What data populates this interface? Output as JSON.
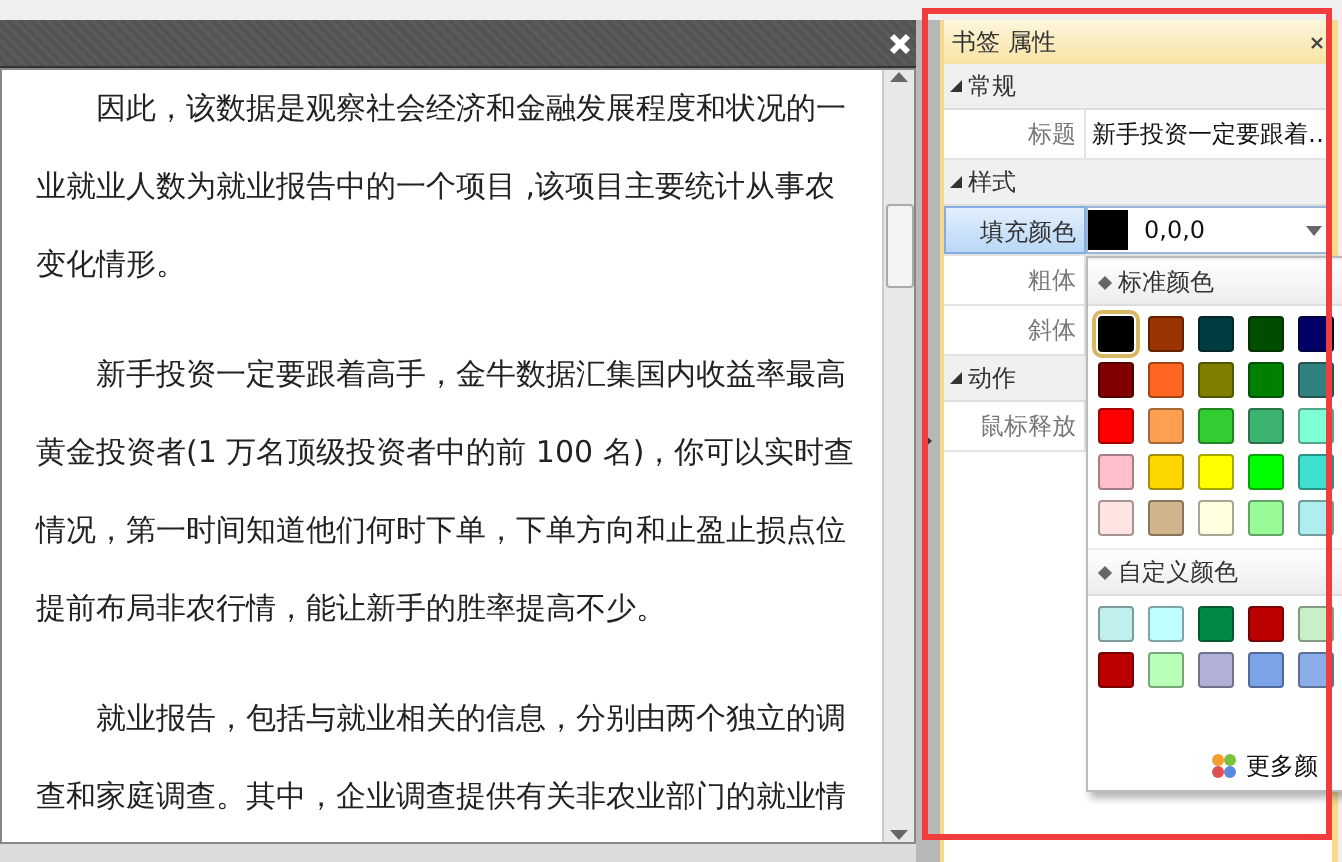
{
  "document": {
    "paragraphs": [
      {
        "lines": [
          "因此，该数据是观察社会经济和金融发展程度和状况的一",
          "业就业人数为就业报告中的一个项目 ,该项目主要统计从事农",
          "变化情形。"
        ]
      },
      {
        "lines": [
          "新手投资一定要跟着高手，金牛数据汇集国内收益率最高",
          "黄金投资者(1 万名顶级投资者中的前 100 名)，你可以实时查",
          "情况，第一时间知道他们何时下单，下单方向和止盈止损点位",
          "提前布局非农行情，能让新手的胜率提高不少。"
        ]
      },
      {
        "lines": [
          "就业报告，包括与就业相关的信息，分别由两个独立的调",
          "查和家庭调查。其中，企业调查提供有关非农业部门的就业情"
        ]
      }
    ]
  },
  "panel": {
    "title": "书签 属性",
    "sections": [
      {
        "label": "常规",
        "expanded": true,
        "rows": [
          {
            "label": "标题",
            "kind": "text",
            "value": "新手投资一定要跟着…",
            "selected": false
          }
        ]
      },
      {
        "label": "样式",
        "expanded": true,
        "rows": [
          {
            "label": "填充颜色",
            "kind": "color",
            "value": "0,0,0",
            "color": "#000000",
            "selected": true
          },
          {
            "label": "粗体",
            "kind": "empty",
            "selected": false
          },
          {
            "label": "斜体",
            "kind": "empty",
            "selected": false
          }
        ]
      },
      {
        "label": "动作",
        "expanded": true,
        "rows": [
          {
            "label": "鼠标释放",
            "kind": "empty",
            "selected": false
          }
        ]
      }
    ]
  },
  "popup": {
    "groups": [
      {
        "title": "标准颜色",
        "swatches": [
          {
            "color": "#000000",
            "selected": true
          },
          {
            "color": "#993300",
            "selected": false
          },
          {
            "color": "#003c40",
            "selected": false
          },
          {
            "color": "#004d00",
            "selected": false
          },
          {
            "color": "#000066",
            "selected": false
          },
          {
            "color": "#800000",
            "selected": false
          },
          {
            "color": "#ff6622",
            "selected": false
          },
          {
            "color": "#808000",
            "selected": false
          },
          {
            "color": "#008000",
            "selected": false
          },
          {
            "color": "#338080",
            "selected": false
          },
          {
            "color": "#ff0000",
            "selected": false
          },
          {
            "color": "#ffa050",
            "selected": false
          },
          {
            "color": "#33cc33",
            "selected": false
          },
          {
            "color": "#3cb371",
            "selected": false
          },
          {
            "color": "#7fffd4",
            "selected": false
          },
          {
            "color": "#ffc0cb",
            "selected": false
          },
          {
            "color": "#ffd700",
            "selected": false
          },
          {
            "color": "#ffff00",
            "selected": false
          },
          {
            "color": "#00ff00",
            "selected": false
          },
          {
            "color": "#40e0d0",
            "selected": false
          },
          {
            "color": "#ffe4e1",
            "selected": false
          },
          {
            "color": "#d2b48c",
            "selected": false
          },
          {
            "color": "#ffffe0",
            "selected": false
          },
          {
            "color": "#98fb98",
            "selected": false
          },
          {
            "color": "#afeeee",
            "selected": false
          }
        ]
      },
      {
        "title": "自定义颜色",
        "swatches": [
          {
            "color": "#bff0ee",
            "selected": false
          },
          {
            "color": "#bfffff",
            "selected": false
          },
          {
            "color": "#008844",
            "selected": false
          },
          {
            "color": "#bb0000",
            "selected": false
          },
          {
            "color": "#c8f0c8",
            "selected": false
          },
          {
            "color": "#bb0000",
            "selected": false
          },
          {
            "color": "#b8ffb8",
            "selected": false
          },
          {
            "color": "#b0b0d8",
            "selected": false
          },
          {
            "color": "#7ba3e8",
            "selected": false
          },
          {
            "color": "#8caee8",
            "selected": false
          }
        ]
      }
    ],
    "more_label": "更多颜"
  }
}
